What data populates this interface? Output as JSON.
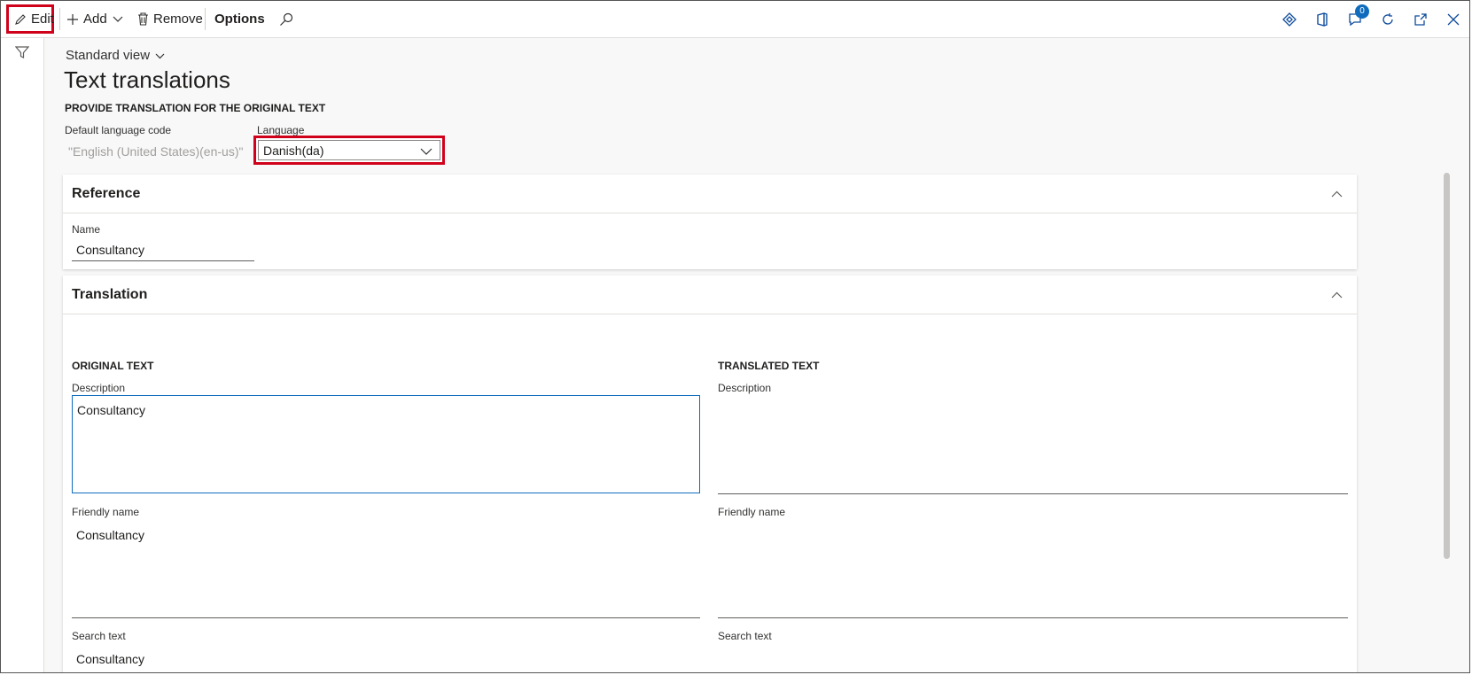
{
  "toolbar": {
    "edit_label": "Edit",
    "add_label": "Add",
    "remove_label": "Remove",
    "options_label": "Options",
    "notification_count": "0"
  },
  "view": {
    "selector_label": "Standard view"
  },
  "page": {
    "title": "Text translations"
  },
  "header_section": {
    "heading": "PROVIDE TRANSLATION FOR THE ORIGINAL TEXT",
    "default_lang_label": "Default language code",
    "default_lang_value": "\"English (United States)(en-us)\"",
    "language_label": "Language",
    "language_value": "Danish(da)"
  },
  "reference": {
    "title": "Reference",
    "name_label": "Name",
    "name_value": "Consultancy"
  },
  "translation": {
    "title": "Translation",
    "original_heading": "ORIGINAL TEXT",
    "translated_heading": "TRANSLATED TEXT",
    "description_label": "Description",
    "description_value": "Consultancy",
    "friendly_label": "Friendly name",
    "friendly_value": "Consultancy",
    "search_label": "Search text",
    "search_value": "Consultancy",
    "translated_description_label": "Description",
    "translated_friendly_label": "Friendly name",
    "translated_search_label": "Search text"
  },
  "colors": {
    "highlight": "#d0021b",
    "accent": "#0f6cbd"
  }
}
